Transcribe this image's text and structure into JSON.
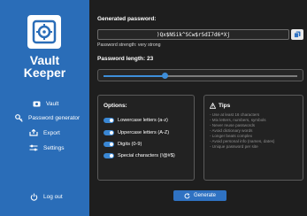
{
  "app": {
    "name_line1": "Vault",
    "name_line2": "Keeper"
  },
  "sidebar": {
    "items": [
      {
        "label": "Vault",
        "icon": "vault-icon"
      },
      {
        "label": "Password generator",
        "icon": "key-icon"
      },
      {
        "label": "Export",
        "icon": "export-icon"
      },
      {
        "label": "Settings",
        "icon": "sliders-icon"
      }
    ],
    "logout": {
      "label": "Log out",
      "icon": "power-icon"
    }
  },
  "generator": {
    "title": "Generated password:",
    "password": ")Qx$NSik^SCw$rSdI7d6*Xj",
    "strength_text": "Password strength: very strong",
    "length_label": "Password length: 23",
    "length": 23,
    "length_min": 4,
    "length_max": 64
  },
  "options": {
    "title": "Options:",
    "items": [
      {
        "label": "Lowercase letters (a-z)",
        "enabled": true
      },
      {
        "label": "Uppercase letters (A-Z)",
        "enabled": true
      },
      {
        "label": "Digits (0-9)",
        "enabled": true
      },
      {
        "label": "Special characters (!@#$)",
        "enabled": true
      }
    ]
  },
  "tips": {
    "title": "Tips",
    "items": [
      "- Use at least 16 characters",
      "- Mix letters, numbers, symbols",
      "- Never reuse passwords",
      "- Avoid dictionary words",
      "- Longer beats complex",
      "- Avoid personal info (names, dates)",
      "- Unique password per site"
    ]
  },
  "generate_button": {
    "label": "Generate",
    "icon": "refresh-icon"
  },
  "colors": {
    "sidebar": "#2a6db8",
    "accent": "#3e8ed9",
    "background": "#1e1e1e"
  }
}
